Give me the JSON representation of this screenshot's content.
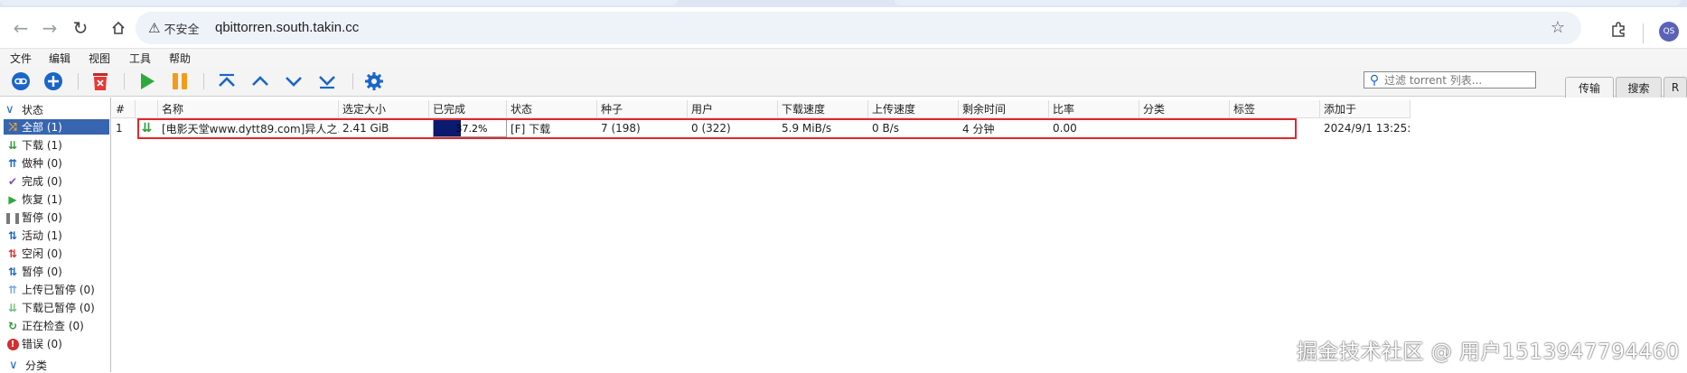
{
  "browser": {
    "security_label": "不安全",
    "url": "qbittorren.south.takin.cc",
    "avatar": "QS"
  },
  "menu": [
    "文件",
    "编辑",
    "视图",
    "工具",
    "帮助"
  ],
  "filter": {
    "placeholder": "过滤 torrent 列表..."
  },
  "side_tabs": [
    "传输",
    "搜索",
    "R"
  ],
  "sidebar": {
    "status_header": "状态",
    "items": [
      {
        "label": "全部 (1)",
        "icon": "all-icon"
      },
      {
        "label": "下载 (1)",
        "icon": "download-icon"
      },
      {
        "label": "做种 (0)",
        "icon": "seeding-icon"
      },
      {
        "label": "完成 (0)",
        "icon": "check-icon"
      },
      {
        "label": "恢复 (1)",
        "icon": "resume-icon"
      },
      {
        "label": "暂停 (0)",
        "icon": "pause-icon"
      },
      {
        "label": "活动 (1)",
        "icon": "active-icon"
      },
      {
        "label": "空闲 (0)",
        "icon": "inactive-icon"
      },
      {
        "label": "暂停 (0)",
        "icon": "stalled-icon"
      },
      {
        "label": "上传已暂停 (0)",
        "icon": "upload-paused-icon"
      },
      {
        "label": "下载已暂停 (0)",
        "icon": "download-paused-icon"
      },
      {
        "label": "正在检查 (0)",
        "icon": "checking-icon"
      },
      {
        "label": "错误 (0)",
        "icon": "error-icon"
      }
    ],
    "category_header": "分类"
  },
  "table": {
    "headers": [
      "#",
      "",
      "名称",
      "选定大小",
      "已完成",
      "状态",
      "种子",
      "用户",
      "下载速度",
      "上传速度",
      "剩余时间",
      "比率",
      "分类",
      "标签",
      "添加于"
    ],
    "rows": [
      {
        "num": "1",
        "name": "[电影天堂www.dytt89.com]异人之...",
        "size": "2.41 GiB",
        "progress_text": "37.2%",
        "progress": 0.372,
        "status": "[F] 下载",
        "seeds": "7 (198)",
        "peers": "0 (322)",
        "dl_speed": "5.9 MiB/s",
        "ul_speed": "0 B/s",
        "eta": "4 分钟",
        "ratio": "0.00",
        "category": "",
        "tags": "",
        "added": "2024/9/1 13:25:..."
      }
    ]
  },
  "watermark": "掘金技术社区 @ 用户1513947794460",
  "colors": {
    "accent": "#1a66c8",
    "selected": "#3865b0",
    "highlight": "#e0282c",
    "progress": "#0a1a6e"
  }
}
